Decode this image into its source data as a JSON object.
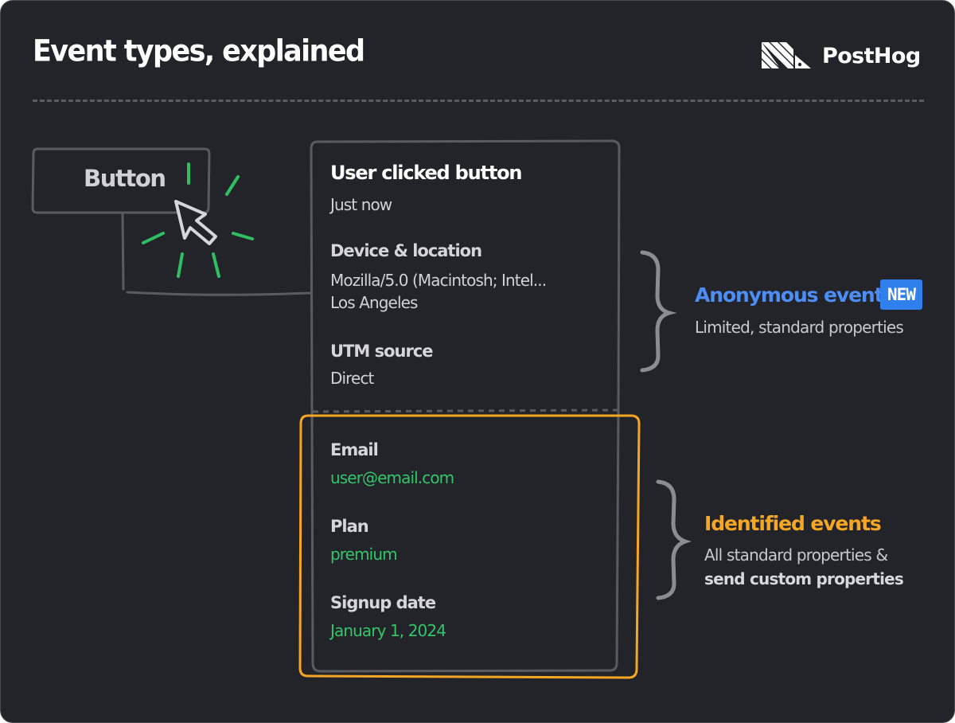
{
  "header": {
    "title": "Event types, explained",
    "brand": "PostHog"
  },
  "button_illustration": {
    "label": "Button"
  },
  "event_card": {
    "title": "User clicked button",
    "timestamp": "Just now",
    "anonymous_properties": [
      {
        "label": "Device & location",
        "values": [
          "Mozilla/5.0 (Macintosh; Intel...",
          "Los Angeles"
        ]
      },
      {
        "label": "UTM source",
        "values": [
          "Direct"
        ]
      }
    ],
    "identified_properties": [
      {
        "label": "Email",
        "value": "user@email.com"
      },
      {
        "label": "Plan",
        "value": "premium"
      },
      {
        "label": "Signup date",
        "value": "January 1, 2024"
      }
    ]
  },
  "anonymous": {
    "title": "Anonymous events",
    "badge": "NEW",
    "description": "Limited, standard properties"
  },
  "identified": {
    "title": "Identified events",
    "description_line1": "All standard properties &",
    "description_line2": "send custom properties"
  },
  "colors": {
    "background": "#23242a",
    "anonymous_accent": "#4c8df6",
    "badge_bg": "#2f80ed",
    "identified_accent": "#f5a623",
    "value_green": "#34c46a",
    "stroke_gray": "#5a5b60"
  }
}
